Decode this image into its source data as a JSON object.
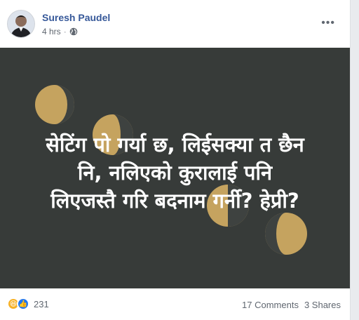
{
  "post": {
    "author": "Suresh Paudel",
    "time": "4 hrs",
    "separator": "·",
    "privacy_icon": "globe-icon",
    "menu_icon": "ellipsis-icon"
  },
  "image": {
    "caption_lines": [
      "सेटिंग पो गर्या छ, लिईसक्या त छैन",
      "नि, नलिएको कुरालाई पनि",
      "लिएजस्तै गरि बदनाम गर्नी? हेप्री?"
    ],
    "background_color": "#373b39",
    "moon_color": "#c5a35f"
  },
  "footer": {
    "reaction_icons": [
      "haha-icon",
      "like-icon"
    ],
    "reaction_count": "231",
    "comments": "17 Comments",
    "shares": "3 Shares"
  }
}
